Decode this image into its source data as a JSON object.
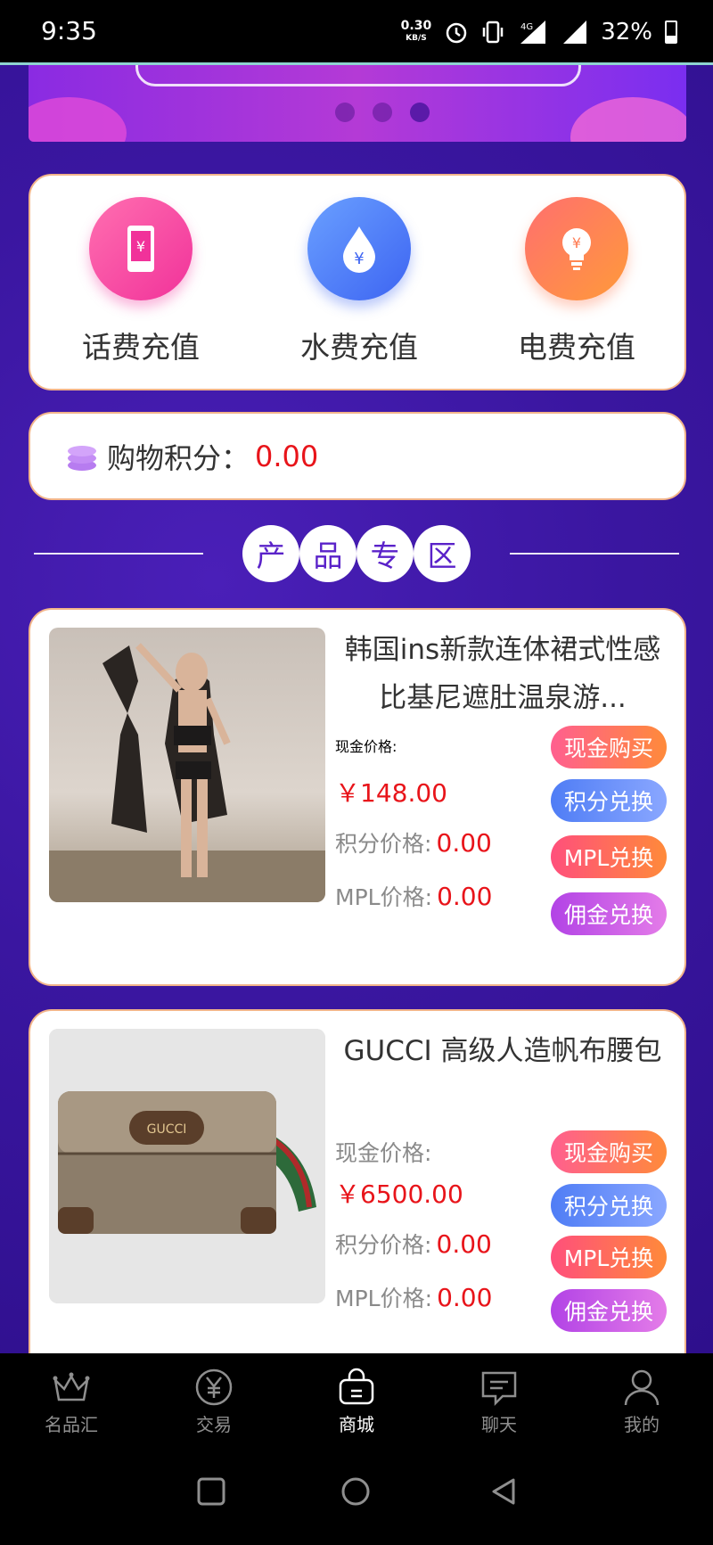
{
  "status_bar": {
    "time": "9:35",
    "net_speed": "0.30",
    "net_unit": "KB/S",
    "network": "4G",
    "battery": "32%"
  },
  "banner": {
    "slide_count": 3,
    "active_slide": 3
  },
  "recharge": [
    {
      "label": "话费充值",
      "icon": "phone-icon"
    },
    {
      "label": "水费充值",
      "icon": "water-drop-icon"
    },
    {
      "label": "电费充值",
      "icon": "light-bulb-icon"
    }
  ],
  "points": {
    "label": "购物积分：",
    "value": "0.00"
  },
  "section": {
    "chars": [
      "产",
      "品",
      "专",
      "区"
    ]
  },
  "products": [
    {
      "name": "韩国ins新款连体裙式性感比基尼遮肚温泉游...",
      "cash_label": "现金价格:",
      "cash_value": "￥148.00",
      "points_label": "积分价格:",
      "points_value": "0.00",
      "mpl_label": "MPL价格:",
      "mpl_value": "0.00"
    },
    {
      "name": "GUCCI 高级人造帆布腰包",
      "cash_label": "现金价格:",
      "cash_value": "￥6500.00",
      "points_label": "积分价格:",
      "points_value": "0.00",
      "mpl_label": "MPL价格:",
      "mpl_value": "0.00"
    }
  ],
  "buttons": {
    "cash": "现金购买",
    "points": "积分兑换",
    "mpl": "MPL兑换",
    "commission": "佣金兑换"
  },
  "bag_logo": "GUCCI",
  "tabs": [
    {
      "label": "名品汇",
      "icon": "crown-icon"
    },
    {
      "label": "交易",
      "icon": "yen-circle-icon"
    },
    {
      "label": "商城",
      "icon": "shopping-bag-icon",
      "active": true
    },
    {
      "label": "聊天",
      "icon": "chat-icon"
    },
    {
      "label": "我的",
      "icon": "person-icon"
    }
  ]
}
